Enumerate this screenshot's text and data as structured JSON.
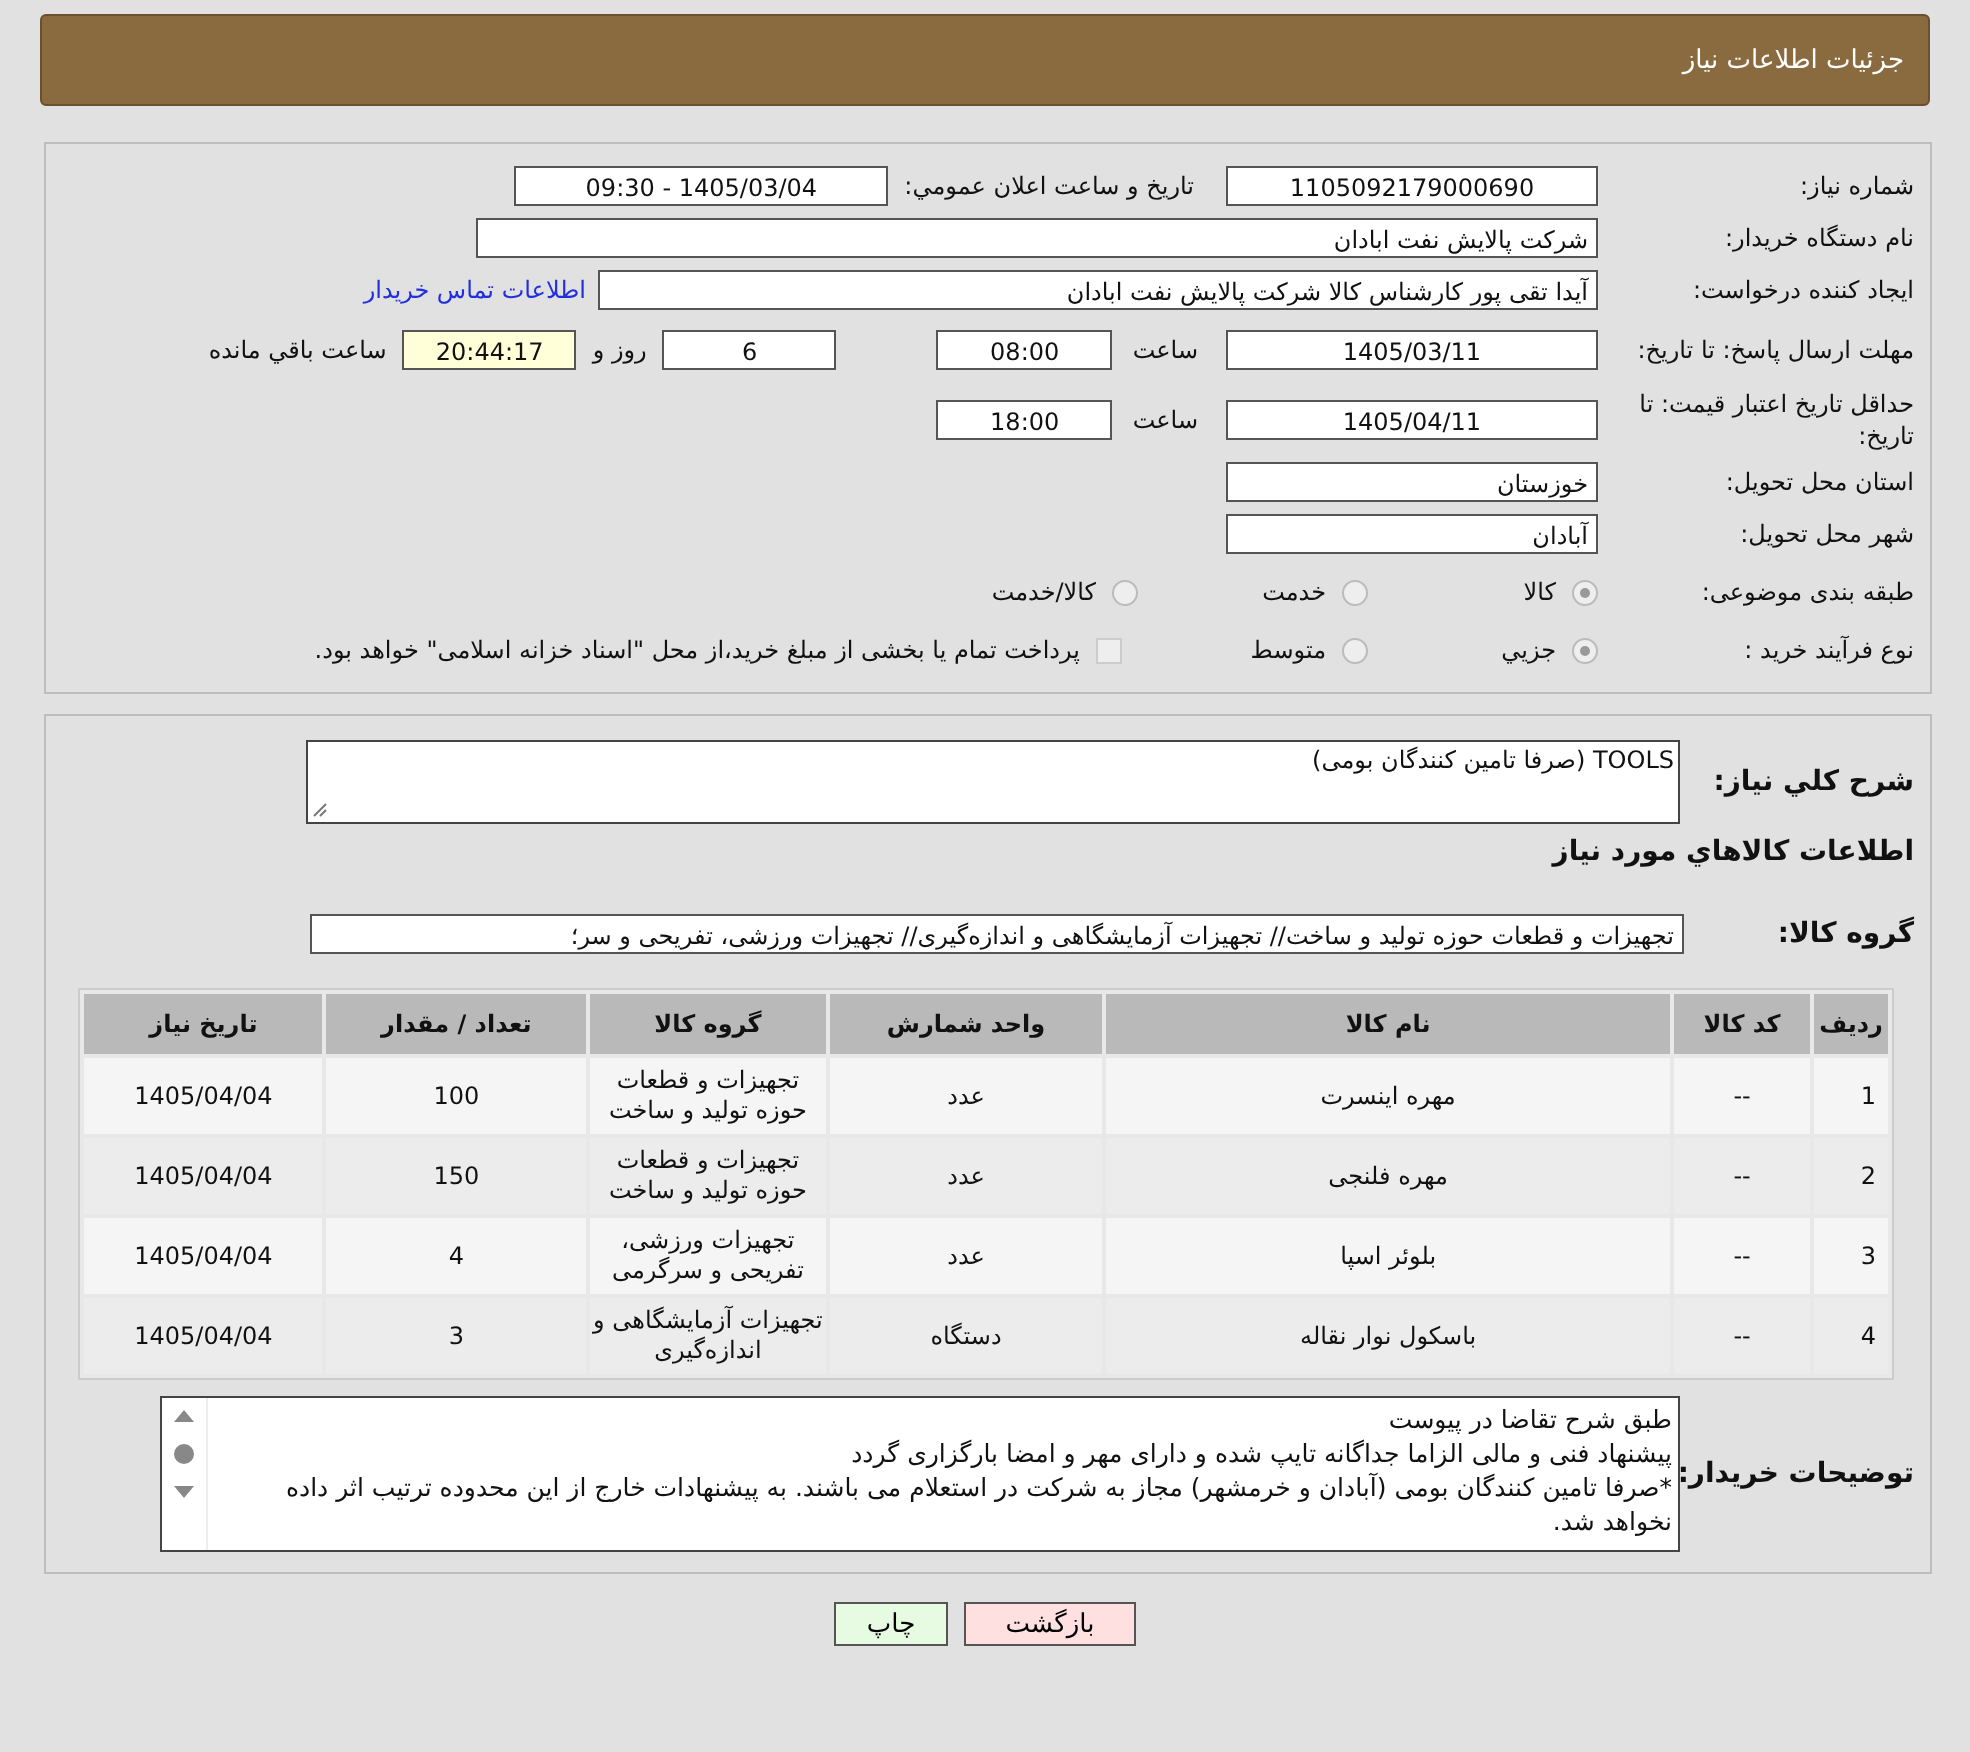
{
  "header": {
    "title": "جزئیات اطلاعات نیاز"
  },
  "form": {
    "need_number": {
      "label": "شماره نیاز:",
      "value": "1105092179000690"
    },
    "announce": {
      "label": "تاریخ و ساعت اعلان عمومي:",
      "value": "1405/03/04 - 09:30"
    },
    "buyer_org": {
      "label": "نام دستگاه خریدار:",
      "value": "شرکت پالایش نفت ابادان"
    },
    "creator": {
      "label": "ایجاد کننده درخواست:",
      "value": "آیدا تقی پور کارشناس کالا شرکت پالایش نفت ابادان",
      "link": "اطلاعات تماس خریدار"
    },
    "deadline": {
      "label": "مهلت ارسال پاسخ: تا تاریخ:",
      "date": "1405/03/11",
      "time_label": "ساعت",
      "time": "08:00",
      "days": "6",
      "days_label": "روز و",
      "remaining": "20:44:17",
      "remaining_label": "ساعت باقي مانده"
    },
    "validity": {
      "label": "حداقل تاریخ اعتبار قیمت: تا تاریخ:",
      "date": "1405/04/11",
      "time_label": "ساعت",
      "time": "18:00"
    },
    "province": {
      "label": "استان محل تحویل:",
      "value": "خوزستان"
    },
    "city": {
      "label": "شهر محل تحویل:",
      "value": "آبادان"
    },
    "category": {
      "label": "طبقه بندی موضوعی:",
      "options": [
        {
          "label": "کالا",
          "selected": true
        },
        {
          "label": "خدمت",
          "selected": false
        },
        {
          "label": "کالا/خدمت",
          "selected": false
        }
      ]
    },
    "process": {
      "label": "نوع فرآیند خرید :",
      "options": [
        {
          "label": "جزيي",
          "selected": true
        },
        {
          "label": "متوسط",
          "selected": false
        }
      ],
      "note_checked": false,
      "note": "پرداخت تمام یا بخشی از مبلغ خرید،از محل \"اسناد خزانه اسلامی\" خواهد بود."
    }
  },
  "details": {
    "description": {
      "label": "شرح کلي نیاز:",
      "value": "TOOLS (صرفا تامین کنندگان بومی)"
    },
    "section_title": "اطلاعات کالاهاي مورد نیاز",
    "group": {
      "label": "گروه کالا:",
      "value": "تجهیزات و قطعات حوزه تولید و ساخت// تجهیزات آزمایشگاهی و اندازه‌گیری// تجهیزات ورزشی، تفریحی و سر؛"
    },
    "table": {
      "columns": [
        "ردیف",
        "کد کالا",
        "نام کالا",
        "واحد شمارش",
        "گروه کالا",
        "تعداد / مقدار",
        "تاریخ نیاز"
      ],
      "rows": [
        [
          "1",
          "--",
          "مهره اینسرت",
          "عدد",
          "تجهیزات و قطعات حوزه تولید و ساخت",
          "100",
          "1405/04/04"
        ],
        [
          "2",
          "--",
          "مهره فلنجی",
          "عدد",
          "تجهیزات و قطعات حوزه تولید و ساخت",
          "150",
          "1405/04/04"
        ],
        [
          "3",
          "--",
          "بلوئر اسپا",
          "عدد",
          "تجهیزات ورزشی، تفریحی و سرگرمی",
          "4",
          "1405/04/04"
        ],
        [
          "4",
          "--",
          "باسکول نوار نقاله",
          "دستگاه",
          "تجهیزات آزمایشگاهی و اندازه‌گیری",
          "3",
          "1405/04/04"
        ]
      ]
    },
    "notes": {
      "label": "توضیحات خریدار:",
      "lines": [
        "طبق شرح تقاضا در پیوست",
        "پیشنهاد فنی و مالی الزاما جداگانه تایپ شده و دارای مهر و امضا بارگزاری گردد",
        "*صرفا تامین کنندگان بومی (آبادان و خرمشهر) مجاز به شرکت در استعلام می باشند. به پیشنهادات خارج از این محدوده ترتیب اثر داده نخواهد شد."
      ]
    }
  },
  "buttons": [
    {
      "label": "بازگشت",
      "kind": "back"
    },
    {
      "label": "چاپ",
      "kind": "print"
    }
  ]
}
